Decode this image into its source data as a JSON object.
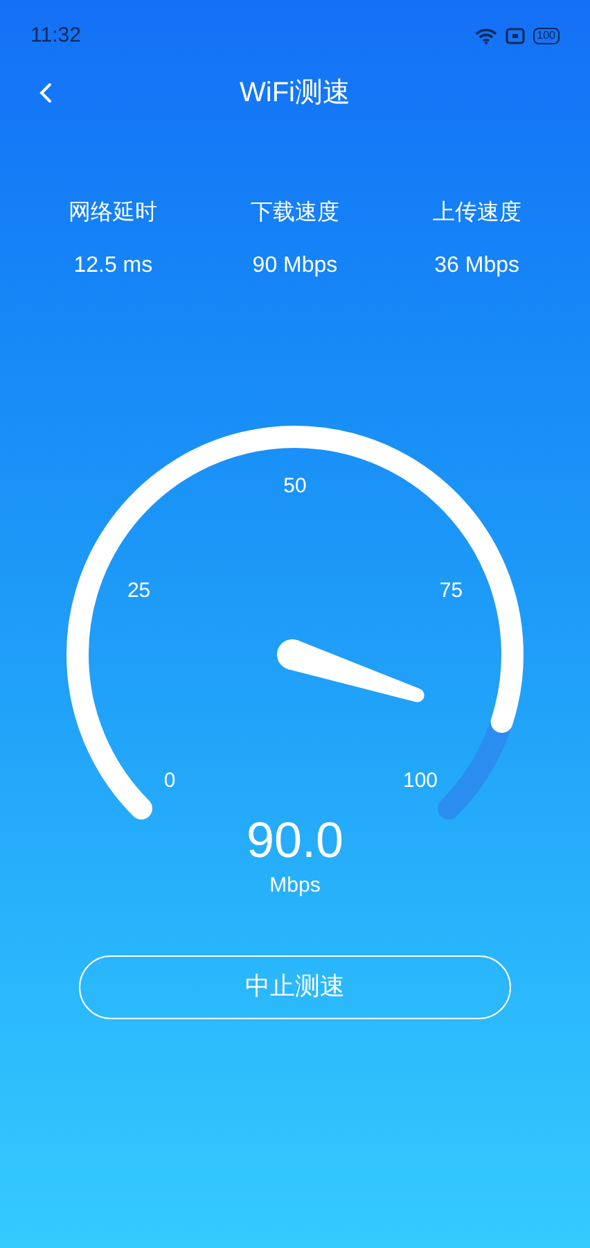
{
  "status_bar": {
    "time": "11:32",
    "battery": "100"
  },
  "header": {
    "title": "WiFi测速"
  },
  "stats": [
    {
      "label": "网络延时",
      "value": "12.5 ms"
    },
    {
      "label": "下载速度",
      "value": "90 Mbps"
    },
    {
      "label": "上传速度",
      "value": "36 Mbps"
    }
  ],
  "gauge": {
    "ticks": [
      "0",
      "25",
      "50",
      "75",
      "100"
    ],
    "reading": "90.0",
    "unit": "Mbps"
  },
  "button": {
    "label": "中止测速"
  }
}
